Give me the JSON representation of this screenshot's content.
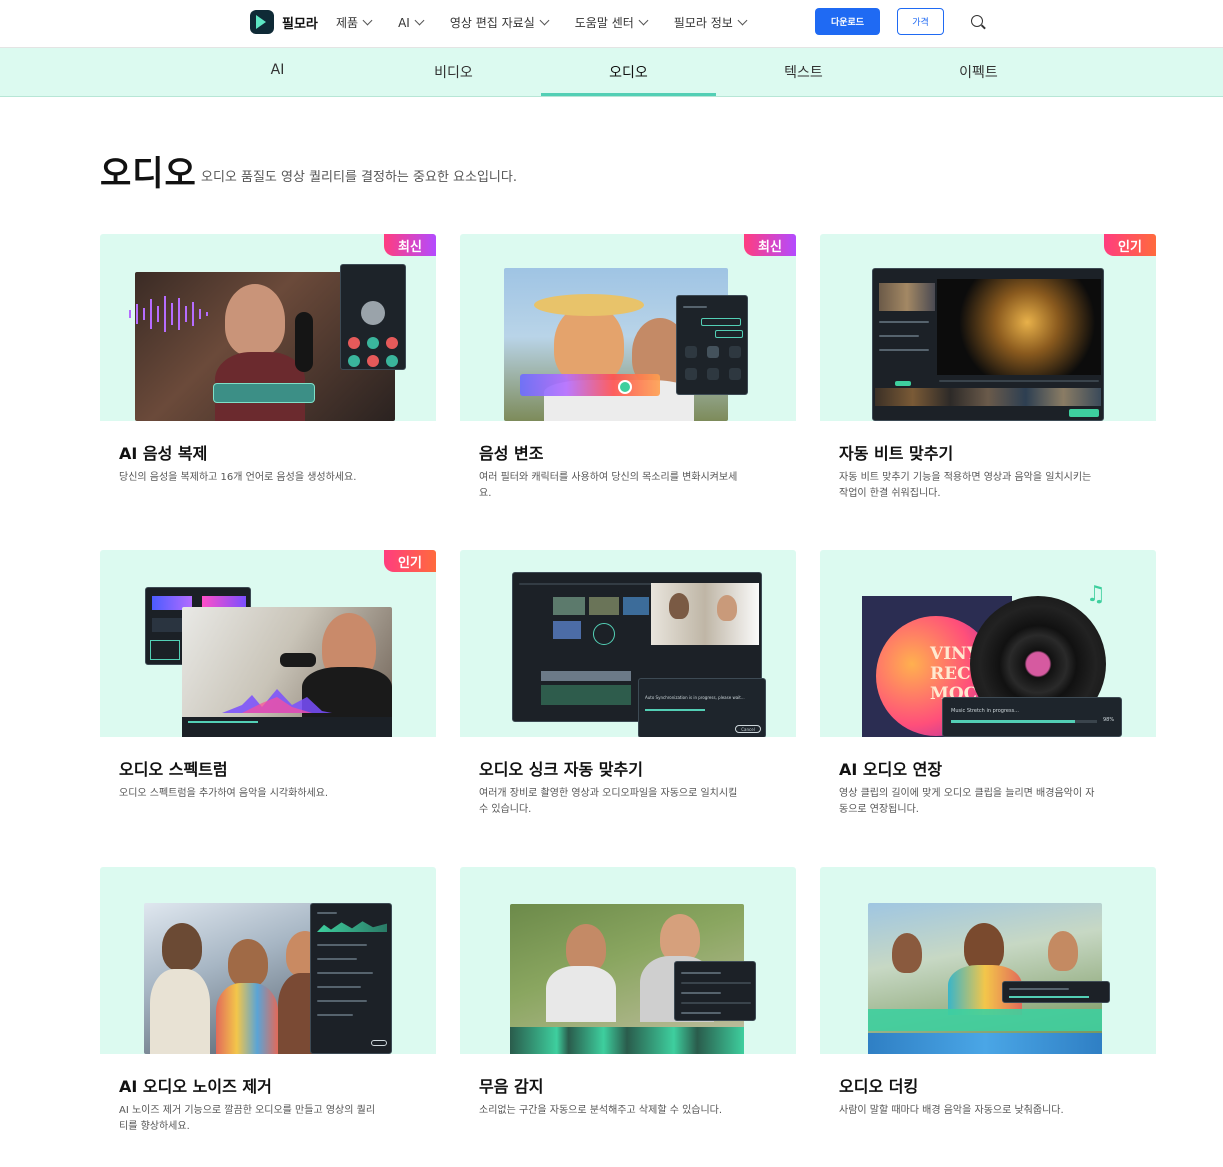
{
  "nav": {
    "brand": "필모라",
    "menu": [
      "제품",
      "AI",
      "영상 편집 자료실",
      "도움말 센터",
      "필모라 정보"
    ],
    "download_label": "다운로드",
    "price_label": "가격"
  },
  "tabs": [
    "AI",
    "비디오",
    "오디오",
    "텍스트",
    "이펙트"
  ],
  "active_tab": "오디오",
  "header": {
    "title": "오디오",
    "subtitle": "오디오 품질도 영상 퀄리티를 결정하는 중요한 요소입니다."
  },
  "cards": [
    {
      "title": "AI 음성 복제",
      "desc": "당신의 음성을 복제하고 16개 언어로 음성을 생성하세요.",
      "badge": "최신"
    },
    {
      "title": "음성 변조",
      "desc": "여러 필터와 캐릭터를 사용하여 당신의 목소리를 변화시켜보세요.",
      "badge": "최신"
    },
    {
      "title": "자동 비트 맞추기",
      "desc": "자동 비트 맞추기 기능을 적용하면 영상과 음악을 일치시키는 작업이 한결 쉬워집니다.",
      "badge": "인기"
    },
    {
      "title": "오디오 스펙트럼",
      "desc": "오디오 스펙트럼을 추가하여 음악을 시각화하세요.",
      "badge": "인기"
    },
    {
      "title": "오디오 싱크 자동 맞추기",
      "desc": "여러개 장비로 촬영한 영상과 오디오파일을 자동으로 일치시킬 수 있습니다.",
      "badge": ""
    },
    {
      "title": "AI 오디오 연장",
      "desc": "영상 클립의 길이에 맞게 오디오 클립을 늘리면 배경음악이 자동으로 연장됩니다.",
      "badge": ""
    },
    {
      "title": "AI 오디오 노이즈 제거",
      "desc": "AI 노이즈 제거 기능으로 깔끔한 오디오를 만들고 영상의 퀄리티를 향상하세요.",
      "badge": ""
    },
    {
      "title": "무음 감지",
      "desc": "소리없는 구간을 자동으로 분석해주고 삭제할 수 있습니다.",
      "badge": ""
    },
    {
      "title": "오디오 더킹",
      "desc": "사람이 말할 때마다 배경 음악을 자동으로 낮춰줍니다.",
      "badge": ""
    }
  ],
  "illustration_text": {
    "vinyl": "VINY\nREC\nMOC",
    "music_stretch": "Music Stretch in progress...",
    "music_stretch_pct": "98%",
    "sync_msg": "Auto Synchronization is in progress, please wait...",
    "sync_cancel": "Cancel"
  },
  "colors": {
    "accent": "#1f6af3",
    "tab_bg": "#dcfaf0",
    "underline": "#53cfb5",
    "badge_new": "#b34bff",
    "badge_pop": "#ff6a3d"
  }
}
